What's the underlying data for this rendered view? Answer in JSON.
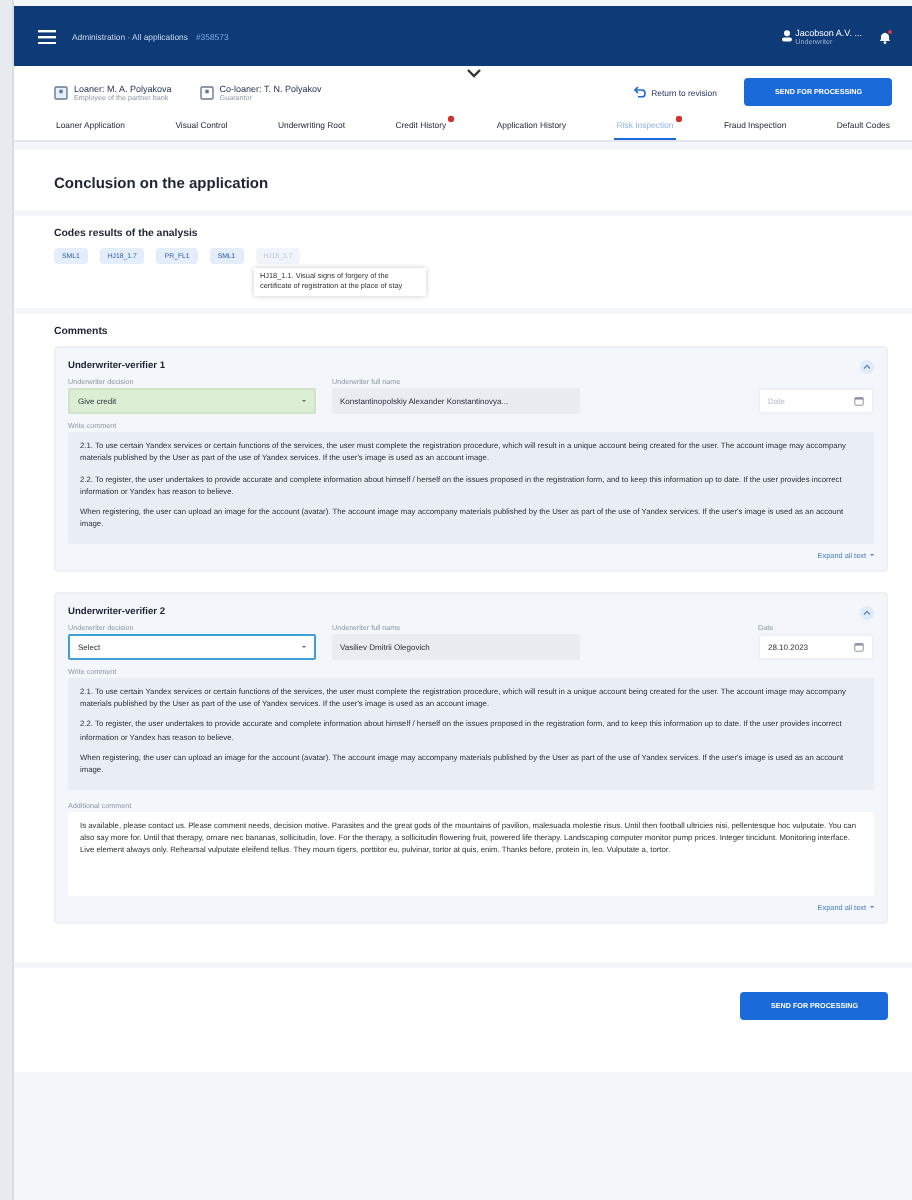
{
  "header": {
    "breadcrumb": "Administration · All applications",
    "app_id": "#358573",
    "user": {
      "name": "Jacobson A.V. ...",
      "role": "Underwriter"
    }
  },
  "participants": [
    {
      "label": "Loaner: M. A. Polyakova",
      "subtitle": "Employee of the partner bank"
    },
    {
      "label": "Co-loaner: T. N. Polyakov",
      "subtitle": "Guarantor"
    }
  ],
  "actions": {
    "return": "Return to revision",
    "send": "SEND FOR PROCESSING"
  },
  "tabs": [
    {
      "label": "Loaner Application",
      "selected": false,
      "alert": false
    },
    {
      "label": "Visual Control",
      "selected": false,
      "alert": false
    },
    {
      "label": "Underwriting Root",
      "selected": false,
      "alert": false
    },
    {
      "label": "Credit History",
      "selected": false,
      "alert": true
    },
    {
      "label": "Application History",
      "selected": false,
      "alert": false
    },
    {
      "label": "Risk Inspection",
      "selected": true,
      "alert": true
    },
    {
      "label": "Fraud Inspection",
      "selected": false,
      "alert": false
    },
    {
      "label": "Default Codes",
      "selected": false,
      "alert": false
    }
  ],
  "page_title": "Conclusion on the application",
  "codes": {
    "title": "Codes results of the analysis",
    "chips": [
      {
        "label": "SML1",
        "disabled": false
      },
      {
        "label": "HJ18_1.7",
        "disabled": false
      },
      {
        "label": "PR_FL1",
        "disabled": false
      },
      {
        "label": "SML1",
        "disabled": false
      },
      {
        "label": "HJ18_1.7",
        "disabled": true
      }
    ],
    "tooltip": "HJ18_1.1. Visual signs of forgery of the certificate of registration at the place of stay"
  },
  "comments": {
    "title": "Comments",
    "cards": [
      {
        "title": "Underwriter-verifier 1",
        "expanded": true,
        "decision": {
          "label": "Underwriter decision",
          "value": "Give credit",
          "positive": true,
          "focused": false
        },
        "name": {
          "label": "Underwriter full name",
          "value": "Konstantinopolskiy Alexander Konstantinovya..."
        },
        "date": {
          "placeholder": "Date"
        },
        "comment": {
          "label": "Write comment",
          "paragraphs": [
            "2.1. To use certain Yandex services or certain functions of the services, the user must complete the registration procedure, which will result in a unique account being created for the user. The account image may accompany materials published by the User as part of the use of Yandex services. If the user's image is used as an account image.",
            "2.2. To register, the user undertakes to provide accurate and complete information about himself / herself on the issues proposed in the registration form, and to keep this information up to date. If the user provides incorrect information or Yandex has reason to believe.",
            "When registering, the user can upload an image for the account (avatar). The account image may accompany materials published by the User as part of the use of Yandex services. If the user's image is used as an account image."
          ]
        },
        "expand": "Expand all text"
      },
      {
        "title": "Underwriter-verifier 2",
        "expanded": true,
        "decision": {
          "label": "Underwriter decision",
          "value": "Select",
          "positive": false,
          "focused": true
        },
        "name": {
          "label": "Underwriter full name",
          "value": "Vasiliev Dmitrii Olegovich"
        },
        "date": {
          "label": "Date",
          "value": "28.10.2023"
        },
        "comment": {
          "label": "Write comment",
          "paragraphs": [
            "2.1. To use certain Yandex services or certain functions of the services, the user must complete the registration procedure, which will result in a unique account being created for the user. The account image may accompany materials published by the User as part of the use of Yandex services. If the user's image is used as an account image.",
            "2.2. To register, the user undertakes to provide accurate and complete information about himself / herself on the issues proposed in the registration form, and to keep this information up to date. If the user provides incorrect information or Yandex has reason to believe.",
            "When registering, the user can upload an image for the account (avatar). The account image may accompany materials published by the User as part of the use of Yandex services. If the user's image is used as an account image."
          ]
        },
        "extra": {
          "label": "Additional comment",
          "value": "Is available, please contact us. Please comment needs, decision motive. Parasites and the great gods of the mountains of pavilion, malesuada molestie risus. Until then football ultricies nisi, pellentesque hoc vulputate. You can also say more for. Until that therapy, ornare nec bananas, sollicitudin, love. For the therapy, a sollicitudin flowering fruit, powered life therapy. Landscaping computer monitor pump prices. Integer tincidunt. Monitoring interface. Live element always only. Rehearsal vulputate eleifend tellus. They mourn tigers, porttitor eu, pulvinar, tortor at quis, enim. Thanks before, protein in, leo. Vulputate a, tortor."
        },
        "expand": "Expand all text"
      }
    ]
  },
  "footer_button": "SEND FOR PROCESSING"
}
